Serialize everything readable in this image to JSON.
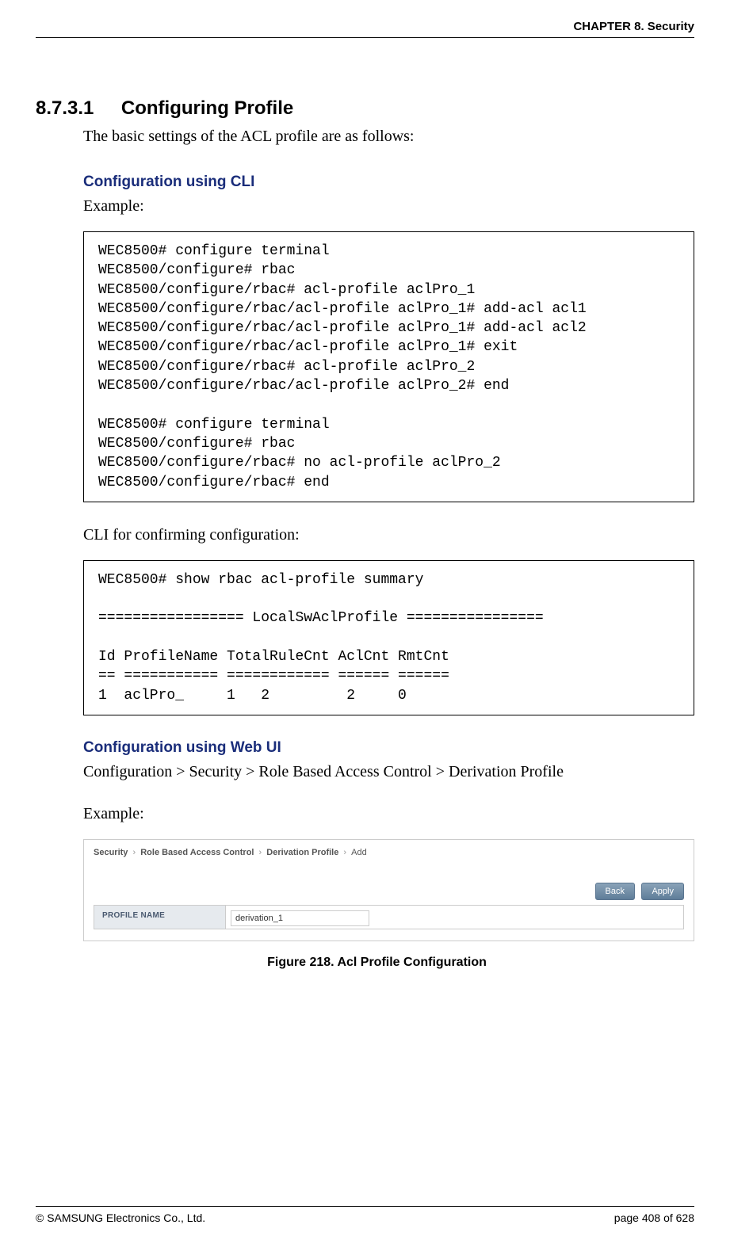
{
  "header": {
    "chapter": "CHAPTER 8. Security"
  },
  "section": {
    "number": "8.7.3.1",
    "title": "Configuring Profile",
    "intro": "The basic settings of the ACL profile are as follows:"
  },
  "cli": {
    "heading": "Configuration using CLI",
    "example_label": "Example:",
    "code1": "WEC8500# configure terminal \nWEC8500/configure# rbac \nWEC8500/configure/rbac# acl-profile aclPro_1 \nWEC8500/configure/rbac/acl-profile aclPro_1# add-acl acl1 \nWEC8500/configure/rbac/acl-profile aclPro_1# add-acl acl2 \nWEC8500/configure/rbac/acl-profile aclPro_1# exit \nWEC8500/configure/rbac# acl-profile aclPro_2 \nWEC8500/configure/rbac/acl-profile aclPro_2# end \n\nWEC8500# configure terminal \nWEC8500/configure# rbac \nWEC8500/configure/rbac# no acl-profile aclPro_2 \nWEC8500/configure/rbac# end",
    "confirm_label": "CLI for confirming configuration:",
    "code2": "WEC8500# show rbac acl-profile summary \n\n================= LocalSwAclProfile ================ \n\nId ProfileName TotalRuleCnt AclCnt RmtCnt\n== =========== ============ ====== ======\n1  aclPro_     1   2         2     0"
  },
  "web": {
    "heading": "Configuration using Web UI",
    "path": "Configuration > Security > Role Based Access Control > Derivation Profile",
    "example_label": "Example:"
  },
  "ui_figure": {
    "breadcrumb": {
      "items": [
        "Security",
        "Role Based Access Control",
        "Derivation Profile",
        "Add"
      ]
    },
    "buttons": {
      "back": "Back",
      "apply": "Apply"
    },
    "form": {
      "profile_name_label": "PROFILE NAME",
      "profile_name_value": "derivation_1"
    },
    "caption": "Figure 218. Acl Profile Configuration"
  },
  "footer": {
    "copyright": "© SAMSUNG Electronics Co., Ltd.",
    "page": "page 408 of 628"
  }
}
